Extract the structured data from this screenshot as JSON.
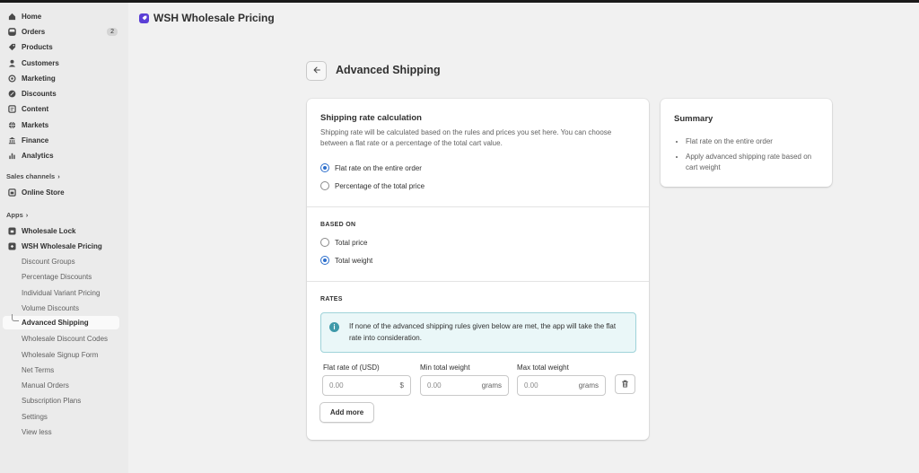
{
  "app": {
    "title": "WSH Wholesale Pricing"
  },
  "sidebar": {
    "items": [
      {
        "label": "Home",
        "icon": "home-icon"
      },
      {
        "label": "Orders",
        "icon": "orders-icon",
        "badge": "2"
      },
      {
        "label": "Products",
        "icon": "tag-icon"
      },
      {
        "label": "Customers",
        "icon": "person-icon"
      },
      {
        "label": "Marketing",
        "icon": "target-icon"
      },
      {
        "label": "Discounts",
        "icon": "discount-icon"
      },
      {
        "label": "Content",
        "icon": "content-icon"
      },
      {
        "label": "Markets",
        "icon": "globe-icon"
      },
      {
        "label": "Finance",
        "icon": "bank-icon"
      },
      {
        "label": "Analytics",
        "icon": "chart-bar-icon"
      }
    ],
    "sales_channels": {
      "title": "Sales channels",
      "items": [
        {
          "label": "Online Store",
          "icon": "store-icon"
        }
      ]
    },
    "apps": {
      "title": "Apps",
      "items": [
        {
          "label": "Wholesale Lock",
          "icon": "app-icon"
        },
        {
          "label": "WSH Wholesale Pricing",
          "icon": "app-icon"
        }
      ],
      "sub_items": [
        "Discount Groups",
        "Percentage Discounts",
        "Individual Variant Pricing",
        "Volume Discounts",
        "Advanced Shipping",
        "Wholesale Discount Codes",
        "Wholesale Signup Form",
        "Net Terms",
        "Manual Orders",
        "Subscription Plans",
        "Settings",
        "View less"
      ],
      "active_sub": "Advanced Shipping"
    }
  },
  "page": {
    "title": "Advanced Shipping",
    "calc": {
      "heading": "Shipping rate calculation",
      "description": "Shipping rate will be calculated based on the rules and prices you set here. You can choose between a flat rate or a percentage of the total cart value.",
      "options": [
        {
          "label": "Flat rate on the entire order",
          "selected": true
        },
        {
          "label": "Percentage of the total price",
          "selected": false
        }
      ]
    },
    "based_on": {
      "heading": "BASED ON",
      "options": [
        {
          "label": "Total price",
          "selected": false
        },
        {
          "label": "Total weight",
          "selected": true
        }
      ]
    },
    "rates": {
      "heading": "RATES",
      "banner": "If none of the advanced shipping rules given below are met, the app will take the flat rate into consideration.",
      "fields": [
        {
          "label": "Flat rate of (USD)",
          "value": "0.00",
          "suffix": "$"
        },
        {
          "label": "Min total weight",
          "value": "0.00",
          "suffix": "grams"
        },
        {
          "label": "Max total weight",
          "value": "0.00",
          "suffix": "grams"
        }
      ],
      "add_more": "Add more"
    },
    "summary": {
      "heading": "Summary",
      "items": [
        "Flat rate on the entire order",
        "Apply advanced shipping rate based on cart weight"
      ]
    }
  },
  "colors": {
    "accent": "#2c6ecb",
    "brand": "#5b3fd6",
    "info": "#3e99a9"
  }
}
